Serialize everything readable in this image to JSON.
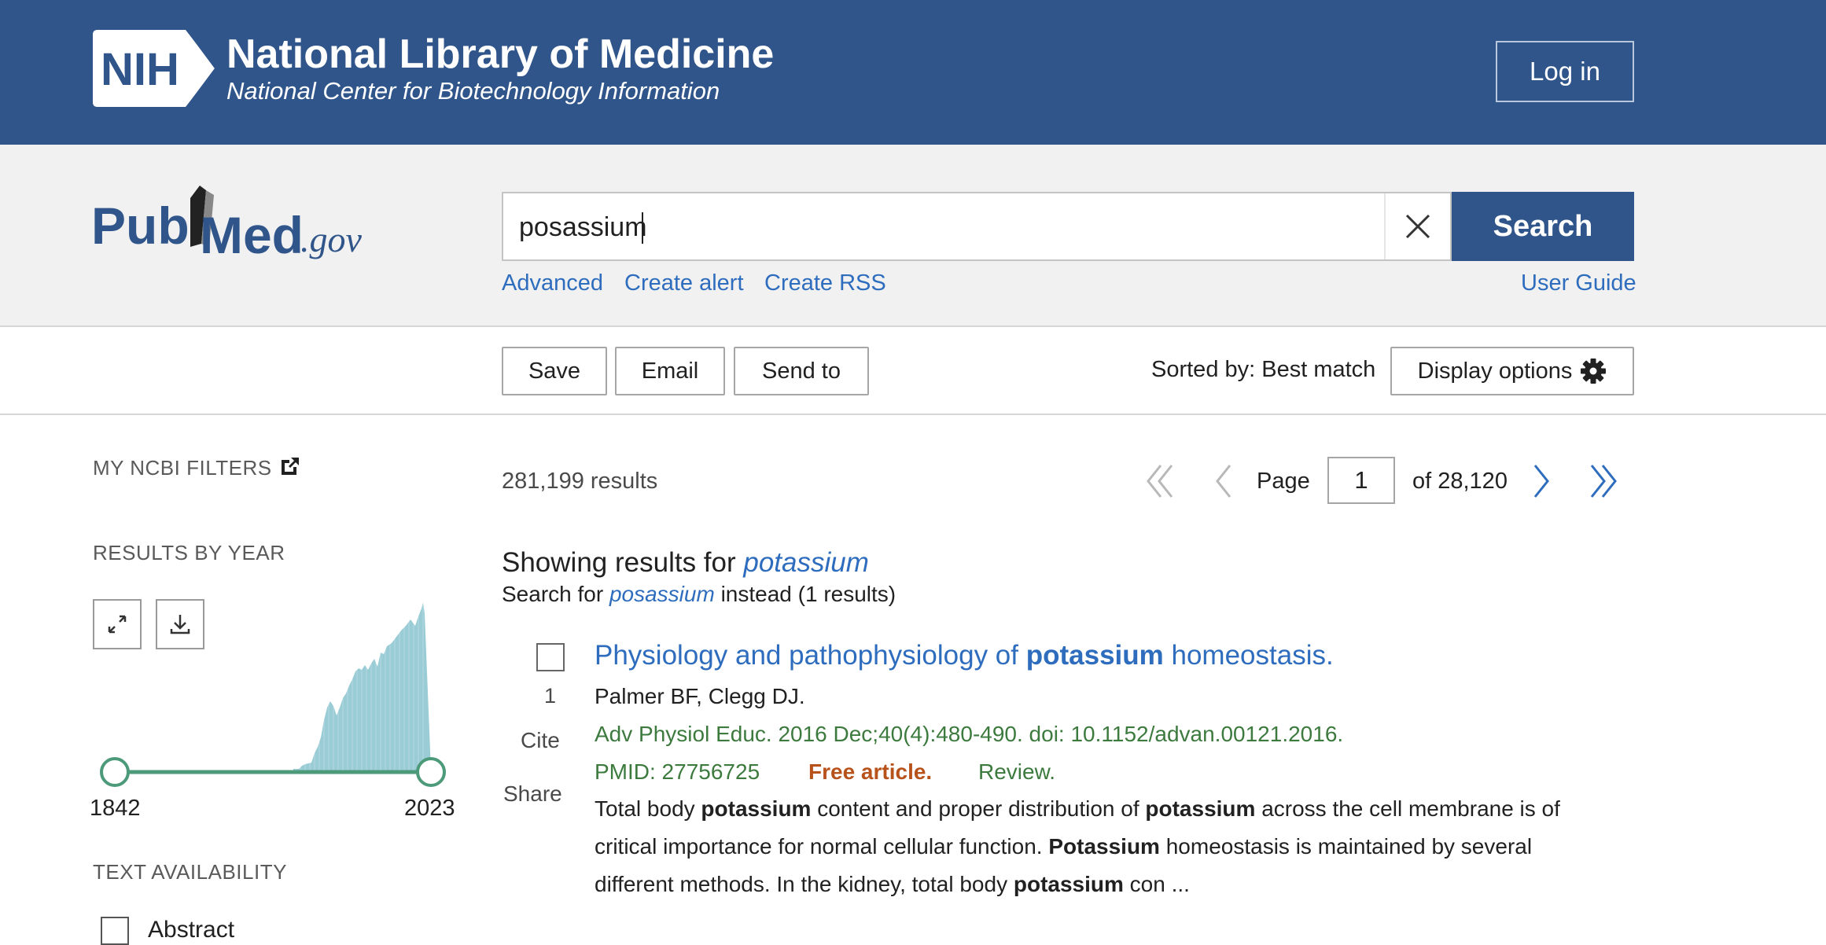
{
  "header": {
    "logo_text": "NIH",
    "org_name": "National Library of Medicine",
    "org_subtitle": "National Center for Biotechnology Information",
    "login_label": "Log in"
  },
  "search": {
    "logo_text_pub": "Pub",
    "logo_text_med": "Med",
    "logo_text_gov": ".gov",
    "query": "posassium",
    "search_label": "Search",
    "links": {
      "advanced": "Advanced",
      "create_alert": "Create alert",
      "create_rss": "Create RSS",
      "user_guide": "User Guide"
    }
  },
  "actions": {
    "save": "Save",
    "email": "Email",
    "send_to": "Send to",
    "sorted_by": "Sorted by: Best match",
    "display_options": "Display options"
  },
  "sidebar": {
    "my_ncbi_filters": "MY NCBI FILTERS",
    "results_by_year": "RESULTS BY YEAR",
    "year_start": "1842",
    "year_end": "2023",
    "text_availability": "TEXT AVAILABILITY",
    "abstract_label": "Abstract"
  },
  "results": {
    "count": "281,199 results",
    "page_label": "Page",
    "page_current": "1",
    "page_of": "of 28,120",
    "showing_prefix": "Showing results for ",
    "showing_term": "potassium",
    "instead_prefix": "Search for ",
    "instead_term": "posassium",
    "instead_suffix": " instead (1 results)",
    "items": [
      {
        "number": "1",
        "cite": "Cite",
        "share": "Share",
        "title_pre": "Physiology and pathophysiology of ",
        "title_bold": "potassium",
        "title_post": " homeostasis.",
        "authors": "Palmer BF, Clegg DJ.",
        "journal": "Adv Physiol Educ. 2016 Dec;40(4):480-490. doi: 10.1152/advan.00121.2016.",
        "pmid": "PMID: 27756725",
        "free": "Free article.",
        "type": "Review.",
        "snippet": {
          "l1a": "Total body ",
          "l1b": "potassium",
          "l1c": " content and proper distribution of ",
          "l1d": "potassium",
          "l1e": " across the cell membrane is of",
          "l2a": "critical importance for normal cellular function. ",
          "l2b": "Potassium",
          "l2c": " homeostasis is maintained by several",
          "l3a": "different methods. In the kidney, total body ",
          "l3b": "potassium",
          "l3c": " con ..."
        }
      }
    ]
  },
  "colors": {
    "banner": "#30558a",
    "link": "#2e6dbe",
    "journal_green": "#3c7a3e",
    "free_orange": "#b8521b",
    "histogram": "#8fc6d2",
    "slider": "#4c9a7a"
  },
  "icons": {
    "login": "none",
    "clear": "close-icon",
    "display": "gear-icon",
    "external": "external-link-icon",
    "expand": "expand-icon",
    "download": "download-icon",
    "first": "double-chevron-left-icon",
    "prev": "chevron-left-icon",
    "next": "chevron-right-icon",
    "last": "double-chevron-right-icon"
  }
}
